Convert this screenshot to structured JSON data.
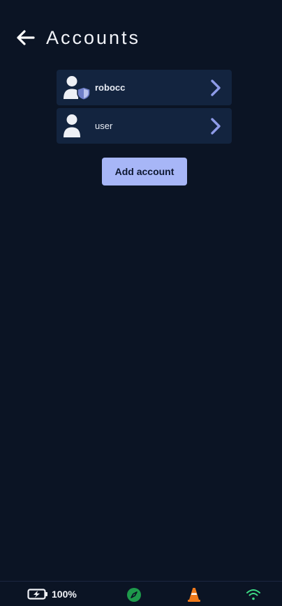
{
  "header": {
    "title": "Accounts",
    "back_icon": "arrow-left-icon"
  },
  "accounts": [
    {
      "name": "robocc",
      "icon": "admin-user-shield-icon"
    },
    {
      "name": "user",
      "icon": "user-icon"
    }
  ],
  "add_account_label": "Add account",
  "statusbar": {
    "battery_text": "100%",
    "battery_icon": "battery-charging-icon",
    "compass_icon": "compass-icon",
    "cone_icon": "traffic-cone-icon",
    "wifi_icon": "wifi-icon"
  },
  "colors": {
    "background": "#0b1424",
    "row_background": "#13243f",
    "accent": "#a7b6f7",
    "chevron": "#8e9be8",
    "shield": "#6f7fc8",
    "compass": "#1e9a4b",
    "cone": "#f07a1a",
    "wifi": "#3ddc84"
  }
}
